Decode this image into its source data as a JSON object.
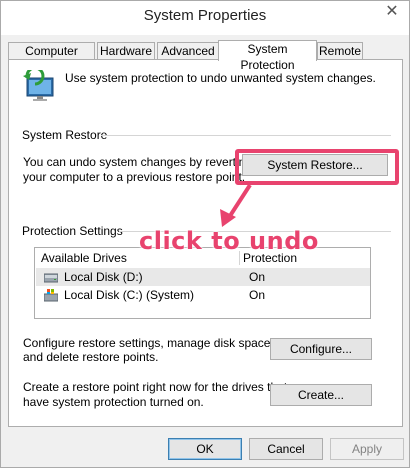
{
  "window": {
    "title": "System Properties",
    "close_glyph": "✕"
  },
  "tabs": [
    {
      "label": "Computer Name"
    },
    {
      "label": "Hardware"
    },
    {
      "label": "Advanced"
    },
    {
      "label": "System Protection",
      "active": true
    },
    {
      "label": "Remote"
    }
  ],
  "intro": {
    "icon": "system-protection-icon",
    "text": "Use system protection to undo unwanted system changes."
  },
  "system_restore": {
    "group_label": "System Restore",
    "line1": "You can undo system changes by reverting",
    "line2": "your computer to a previous restore point.",
    "button_label": "System Restore..."
  },
  "protection": {
    "group_label": "Protection Settings",
    "columns": [
      "Available Drives",
      "Protection"
    ],
    "drives": [
      {
        "name": "Local Disk (D:)",
        "protection": "On",
        "icon": "drive-icon",
        "selected": true
      },
      {
        "name": "Local Disk (C:) (System)",
        "protection": "On",
        "icon": "system-drive-icon",
        "selected": false
      }
    ],
    "configure_line1": "Configure restore settings, manage disk space,",
    "configure_line2": "and delete restore points.",
    "configure_label": "Configure...",
    "create_line1": "Create a restore point right now for the drives that",
    "create_line2": "have system protection turned on.",
    "create_label": "Create..."
  },
  "annotation": {
    "text": "click to undo",
    "color": "#e8436e"
  },
  "footer": {
    "ok_label": "OK",
    "cancel_label": "Cancel",
    "apply_label": "Apply"
  }
}
